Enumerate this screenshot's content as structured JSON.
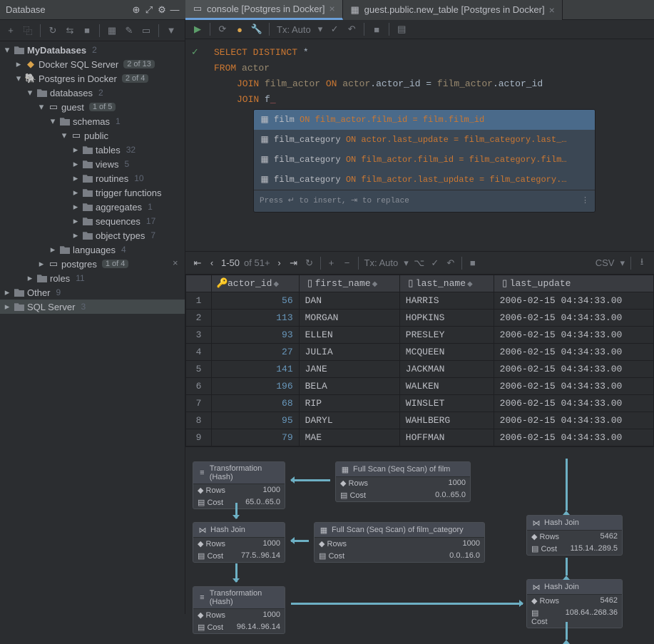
{
  "title": "Database",
  "tabs": [
    {
      "label": "console [Postgres in Docker]",
      "active": true
    },
    {
      "label": "guest.public.new_table [Postgres in Docker]",
      "active": false
    }
  ],
  "tx_label": "Tx: Auto",
  "tree": {
    "root": "MyDatabases",
    "root_count": "2",
    "docker": "Docker SQL Server",
    "docker_badge": "2 of 13",
    "postgres": "Postgres in Docker",
    "postgres_badge": "2 of 4",
    "databases": "databases",
    "databases_count": "2",
    "guest": "guest",
    "guest_badge": "1 of 5",
    "schemas": "schemas",
    "schemas_count": "1",
    "public": "public",
    "tables": "tables",
    "tables_count": "32",
    "views": "views",
    "views_count": "5",
    "routines": "routines",
    "routines_count": "10",
    "triggerfn": "trigger functions",
    "aggregates": "aggregates",
    "aggregates_count": "1",
    "sequences": "sequences",
    "sequences_count": "17",
    "objecttypes": "object types",
    "objecttypes_count": "7",
    "languages": "languages",
    "languages_count": "4",
    "postgres_db": "postgres",
    "postgres_db_badge": "1 of 4",
    "roles": "roles",
    "roles_count": "11",
    "other": "Other",
    "other_count": "9",
    "sqlserver": "SQL Server",
    "sqlserver_count": "3"
  },
  "sql": {
    "line1a": "SELECT DISTINCT",
    "line1b": "*",
    "line2a": "FROM",
    "line2b": "actor",
    "line3a": "JOIN",
    "line3b": "film_actor",
    "line3c": "ON",
    "line3d": "actor",
    "line3e": ".actor_id = ",
    "line3f": "film_actor",
    "line3g": ".actor_id",
    "line4a": "JOIN",
    "line4b": "f"
  },
  "autocomplete": {
    "rows": [
      {
        "name": "film",
        "rest": " ON film_actor.film_id = film.film_id"
      },
      {
        "name": "film_category",
        "rest": " ON actor.last_update = film_category.last_…"
      },
      {
        "name": "film_category",
        "rest": " ON film_actor.film_id = film_category.film…"
      },
      {
        "name": "film_category",
        "rest": " ON film_actor.last_update = film_category.…"
      }
    ],
    "hint": "Press ↵ to insert, ⇥ to replace"
  },
  "pager": {
    "range": "1-50",
    "of": "of 51+"
  },
  "res_tx": "Tx: Auto",
  "export": "CSV",
  "columns": [
    "actor_id",
    "first_name",
    "last_name",
    "last_update"
  ],
  "rows": [
    {
      "n": "1",
      "id": "56",
      "fn": "DAN",
      "ln": "HARRIS",
      "lu": "2006-02-15 04:34:33.00"
    },
    {
      "n": "2",
      "id": "113",
      "fn": "MORGAN",
      "ln": "HOPKINS",
      "lu": "2006-02-15 04:34:33.00"
    },
    {
      "n": "3",
      "id": "93",
      "fn": "ELLEN",
      "ln": "PRESLEY",
      "lu": "2006-02-15 04:34:33.00"
    },
    {
      "n": "4",
      "id": "27",
      "fn": "JULIA",
      "ln": "MCQUEEN",
      "lu": "2006-02-15 04:34:33.00"
    },
    {
      "n": "5",
      "id": "141",
      "fn": "JANE",
      "ln": "JACKMAN",
      "lu": "2006-02-15 04:34:33.00"
    },
    {
      "n": "6",
      "id": "196",
      "fn": "BELA",
      "ln": "WALKEN",
      "lu": "2006-02-15 04:34:33.00"
    },
    {
      "n": "7",
      "id": "68",
      "fn": "RIP",
      "ln": "WINSLET",
      "lu": "2006-02-15 04:34:33.00"
    },
    {
      "n": "8",
      "id": "95",
      "fn": "DARYL",
      "ln": "WAHLBERG",
      "lu": "2006-02-15 04:34:33.00"
    },
    {
      "n": "9",
      "id": "79",
      "fn": "MAE",
      "ln": "HOFFMAN",
      "lu": "2006-02-15 04:34:33.00"
    }
  ],
  "plan": {
    "n1": {
      "title": "Transformation (Hash)",
      "rows": "1000",
      "cost": "65.0..65.0"
    },
    "n2": {
      "title": "Full Scan (Seq Scan) of film",
      "rows": "1000",
      "cost": "0.0..65.0"
    },
    "n3": {
      "title": "Hash Join",
      "rows": "1000",
      "cost": "77.5..96.14"
    },
    "n4": {
      "title": "Full Scan (Seq Scan) of film_category",
      "rows": "1000",
      "cost": "0.0..16.0"
    },
    "n5": {
      "title": "Transformation (Hash)",
      "rows": "1000",
      "cost": "96.14..96.14"
    },
    "n6": {
      "title": "Hash Join",
      "rows": "5462",
      "cost": "115.14..289.5"
    },
    "n7": {
      "title": "Hash Join",
      "rows": "5462",
      "cost": "108.64..268.36"
    },
    "rows_label": "Rows",
    "cost_label": "Cost"
  }
}
